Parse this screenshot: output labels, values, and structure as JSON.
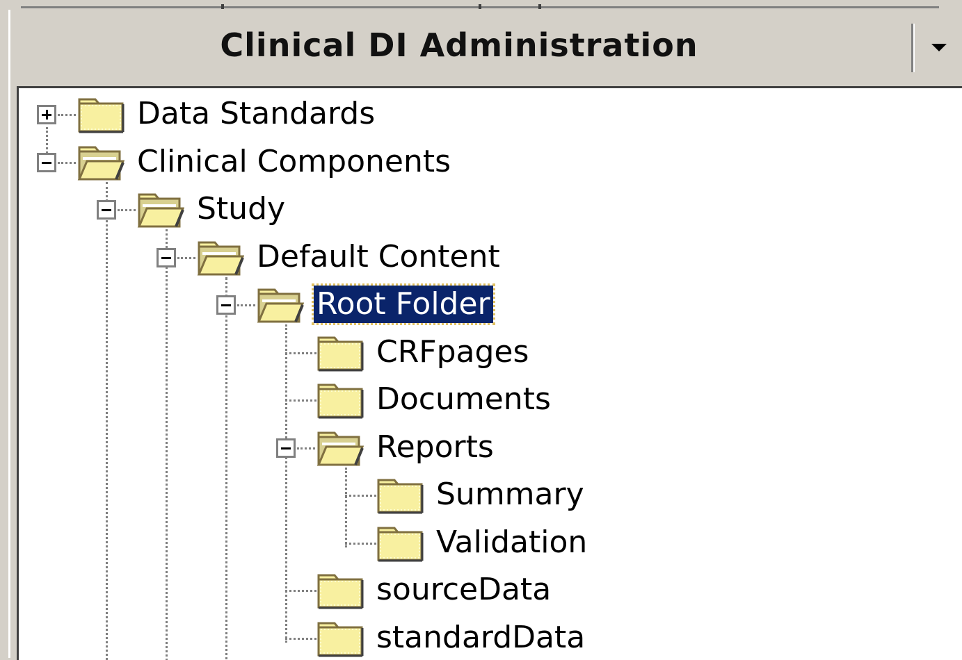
{
  "panel": {
    "title": "Clinical DI Administration",
    "menu_icon": "dropdown-arrow-icon"
  },
  "tree": {
    "nodes": [
      {
        "label": "Data Standards",
        "level": 0,
        "state": "collapsed",
        "icon": "folder-closed-icon"
      },
      {
        "label": "Clinical Components",
        "level": 0,
        "state": "expanded",
        "icon": "folder-open-icon"
      },
      {
        "label": "Study",
        "level": 1,
        "state": "expanded",
        "icon": "folder-open-icon"
      },
      {
        "label": "Default Content",
        "level": 2,
        "state": "expanded",
        "icon": "folder-open-icon"
      },
      {
        "label": "Root Folder",
        "level": 3,
        "state": "expanded",
        "icon": "folder-open-icon",
        "selected": true
      },
      {
        "label": "CRFpages",
        "level": 4,
        "state": "leaf",
        "icon": "folder-closed-icon"
      },
      {
        "label": "Documents",
        "level": 4,
        "state": "leaf",
        "icon": "folder-closed-icon"
      },
      {
        "label": "Reports",
        "level": 4,
        "state": "expanded",
        "icon": "folder-open-icon"
      },
      {
        "label": "Summary",
        "level": 5,
        "state": "leaf",
        "icon": "folder-closed-icon"
      },
      {
        "label": "Validation",
        "level": 5,
        "state": "leaf",
        "icon": "folder-closed-icon"
      },
      {
        "label": "sourceData",
        "level": 4,
        "state": "leaf",
        "icon": "folder-closed-icon"
      },
      {
        "label": "standardData",
        "level": 4,
        "state": "leaf",
        "icon": "folder-closed-icon"
      }
    ]
  },
  "colors": {
    "selection_bg": "#0a246a",
    "panel_bg": "#d4d0c8",
    "folder_fill": "#f8f0a0"
  }
}
